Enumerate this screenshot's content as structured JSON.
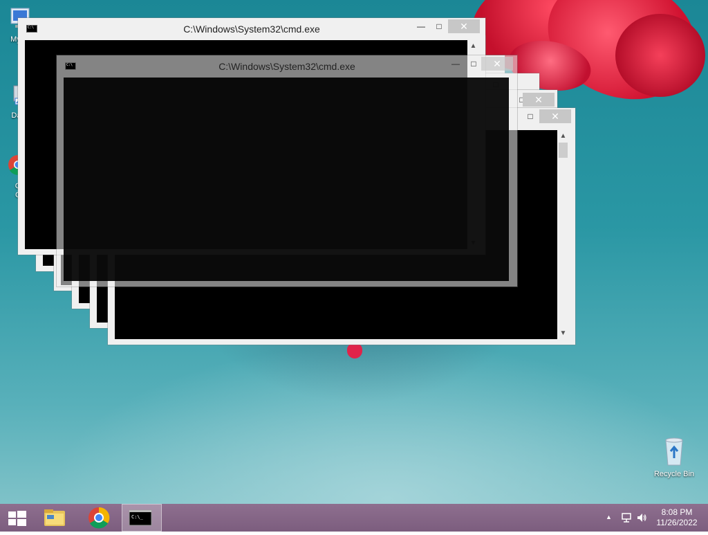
{
  "desktop": {
    "icons": [
      {
        "label": "My C",
        "icon": "computer-icon"
      },
      {
        "label": "Data",
        "icon": "shortcut-icon"
      },
      {
        "label": "G\nC",
        "icon": "chrome-icon"
      },
      {
        "label": "Recycle Bin",
        "icon": "recycle-bin-icon"
      }
    ]
  },
  "windows": [
    {
      "title": "C:\\Windows\\System32\\cmd.exe",
      "state": "front"
    },
    {
      "title": "C:\\Windows\\System32\\cmd.exe",
      "state": "ghost"
    },
    {
      "title": "",
      "state": "stacked"
    },
    {
      "title": "",
      "state": "stacked"
    },
    {
      "title": "",
      "state": "stacked"
    }
  ],
  "controls": {
    "minimize": "—",
    "maximize": "□",
    "close": "✕",
    "scroll_up": "▲",
    "scroll_down": "▼"
  },
  "taskbar": {
    "pinned": [
      {
        "name": "File Explorer",
        "icon": "file-explorer-icon"
      },
      {
        "name": "Google Chrome",
        "icon": "chrome-icon"
      },
      {
        "name": "Command Prompt",
        "icon": "cmd-icon",
        "active": true
      }
    ],
    "tray": {
      "time": "8:08 PM",
      "date": "11/26/2022"
    }
  },
  "colors": {
    "accent": "#7c5d7e",
    "console_bg": "#000000",
    "flower": "#e0233f"
  }
}
